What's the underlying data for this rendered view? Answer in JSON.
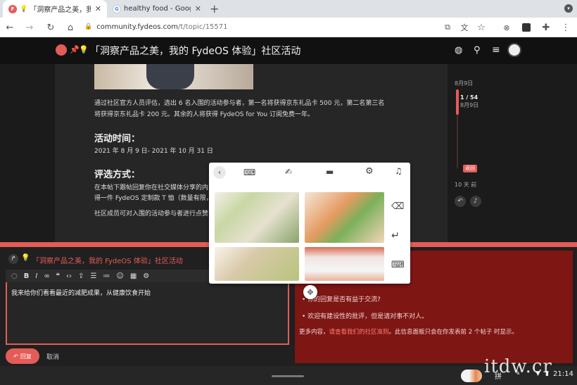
{
  "tabs": [
    {
      "title": "「洞察产品之美，我的 F",
      "favicon": "F"
    },
    {
      "title": "healthy food - Google Search",
      "favicon": "G"
    }
  ],
  "address": {
    "domain": "community.fydeos.com",
    "path": "/t/topic/15571"
  },
  "topic_title": "「洞察产品之美，我的 FydeOS 体验」社区活动",
  "post": {
    "para1": "通过社区官方人员评估，选出 6 名入围的活动参与者，第一名将获得京东礼品卡 500 元，第二名第三名将获得京东礼品卡 200 元。其余的人将获得 FydeOS for You 订阅免费一年。",
    "time_heading": "活动时间：",
    "time_value": "2021 年 8 月 9 日- 2021 年 10 月 31 日",
    "rule_heading": "评选方式：",
    "rule_line1": "在本帖下跟帖回复你在社交媒体分享的内",
    "rule_line2": "得一件 FydeOS 定制款 T 恤（数量有限，",
    "rule_line3": "社区成员可对入围的活动参与者进行点赞"
  },
  "timeline": {
    "start_date": "8月9日",
    "position": "1 / 54",
    "position_date": "8月9日",
    "back_label": "返回",
    "ago": "10 天 前"
  },
  "composer": {
    "reply_to": "「洞察产品之美，我的 FydeOS 体验」社区活动",
    "body": "我来给你们看看最近的减肥成果，从健康饮食开始",
    "reply_button": "回复",
    "cancel_button": "取消",
    "esc": "esc"
  },
  "preview": {
    "bullet1": "你的回复是否有益于交流?",
    "bullet2": "欢迎有建设性的批评，但是请对事不对人。",
    "more_prefix": "更多内容，",
    "more_link": "请查看我们的社区准则",
    "more_suffix": "。此信息面板只会在你发表前 2 个帖子 时显示。"
  },
  "shelf": {
    "ime": "拼",
    "time": "21:14"
  },
  "colors": {
    "accent": "#e45c58",
    "preview_bg": "#7e1614",
    "dark_bg": "#1b1b1b"
  },
  "watermark": "itdw.cr"
}
